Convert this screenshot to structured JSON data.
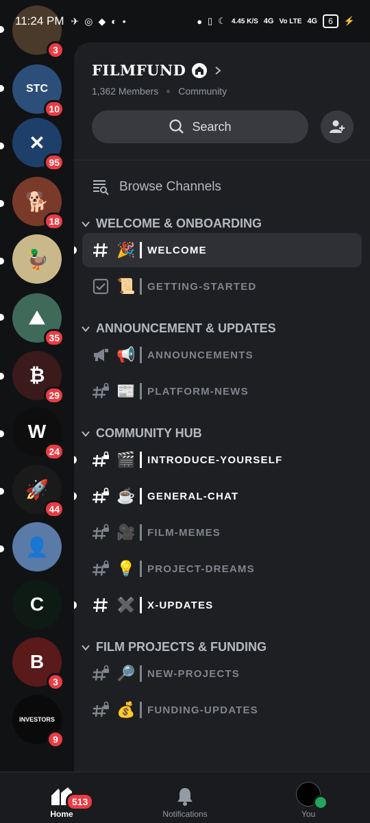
{
  "status_bar": {
    "time": "11:24 PM",
    "net_speed": "4.45 K/S",
    "sig1": "4G",
    "sig2": "Vo LTE",
    "sig3": "4G",
    "battery": "6"
  },
  "servers": [
    {
      "name": "server-1",
      "badge": "3",
      "color": "#4a3a2a",
      "glyph": ""
    },
    {
      "name": "stc-server",
      "badge": "10",
      "color": "#2c4f7a",
      "glyph": "STC"
    },
    {
      "name": "swords-server",
      "badge": "95",
      "color": "#1f3f6b",
      "glyph": "✕"
    },
    {
      "name": "dog-server",
      "badge": "18",
      "color": "#7a3a2a",
      "glyph": "🐕"
    },
    {
      "name": "scrooge-server",
      "badge": "",
      "color": "#c9b98a",
      "glyph": "🦆"
    },
    {
      "name": "btc-adventure-server",
      "badge": "35",
      "color": "#3f6a5a",
      "glyph": "⛰"
    },
    {
      "name": "bitcoin-server",
      "badge": "29",
      "color": "#3a1a1a",
      "glyph": "₿"
    },
    {
      "name": "w-server",
      "badge": "24",
      "color": "#0e0e0e",
      "glyph": "W"
    },
    {
      "name": "rocket-server",
      "badge": "44",
      "color": "#1a1a1a",
      "glyph": "🚀"
    },
    {
      "name": "character-server",
      "badge": "",
      "color": "#5a7aa8",
      "glyph": "👤"
    },
    {
      "name": "c-server",
      "badge": "",
      "color": "#0e1a14",
      "glyph": "C"
    },
    {
      "name": "b-server",
      "badge": "3",
      "color": "#5a1a1a",
      "glyph": "B"
    },
    {
      "name": "investors-guild-server",
      "badge": "9",
      "color": "#0a0a0a",
      "glyph": "INVESTORS"
    }
  ],
  "server": {
    "name": "FILMFUND",
    "members": "1,362 Members",
    "type": "Community"
  },
  "search_label": "Search",
  "browse_label": "Browse Channels",
  "categories": [
    {
      "label": "WELCOME & ONBOARDING",
      "channels": [
        {
          "emoji": "🎉",
          "label": "WELCOME",
          "state": "active",
          "icon": "hash"
        },
        {
          "emoji": "📜",
          "label": "GETTING-STARTED",
          "state": "normal",
          "icon": "rules"
        }
      ]
    },
    {
      "label": "ANNOUNCEMENT & UPDATES",
      "channels": [
        {
          "emoji": "📢",
          "label": "ANNOUNCEMENTS",
          "state": "normal",
          "icon": "announce"
        },
        {
          "emoji": "📰",
          "label": "PLATFORM-NEWS",
          "state": "normal",
          "icon": "hash-lock"
        }
      ]
    },
    {
      "label": "COMMUNITY HUB",
      "channels": [
        {
          "emoji": "🎬",
          "label": "INTRODUCE-YOURSELF",
          "state": "unread",
          "icon": "hash-lock"
        },
        {
          "emoji": "☕",
          "label": "GENERAL-CHAT",
          "state": "unread",
          "icon": "hash-lock"
        },
        {
          "emoji": "🎥",
          "label": "FILM-MEMES",
          "state": "normal",
          "icon": "hash-lock"
        },
        {
          "emoji": "💡",
          "label": "PROJECT-DREAMS",
          "state": "normal",
          "icon": "hash-lock"
        },
        {
          "emoji": "✖️",
          "label": "X-UPDATES",
          "state": "unread",
          "icon": "hash"
        }
      ]
    },
    {
      "label": "FILM PROJECTS & FUNDING",
      "channels": [
        {
          "emoji": "🔎",
          "label": "NEW-PROJECTS",
          "state": "normal",
          "icon": "hash-lock"
        },
        {
          "emoji": "💰",
          "label": "FUNDING-UPDATES",
          "state": "normal",
          "icon": "hash-lock"
        }
      ]
    }
  ],
  "nav": {
    "home": "Home",
    "home_badge": "513",
    "notifications": "Notifications",
    "you": "You"
  }
}
